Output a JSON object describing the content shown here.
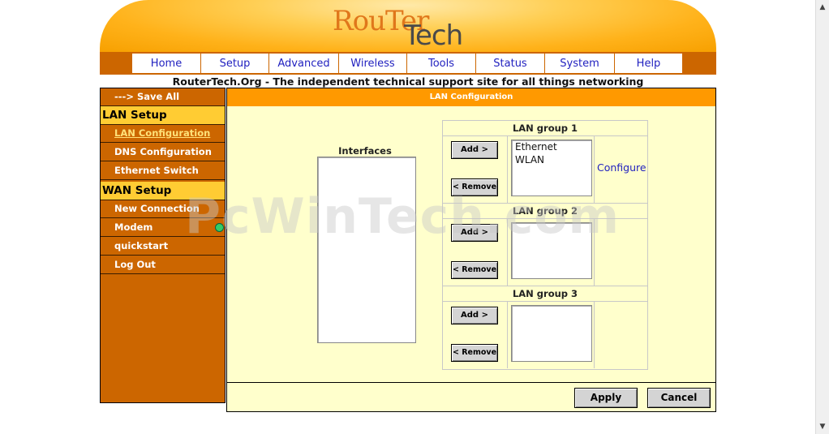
{
  "logo": {
    "part1": "RouTer",
    "part2": "Tech"
  },
  "nav": [
    "Home",
    "Setup",
    "Advanced",
    "Wireless",
    "Tools",
    "Status",
    "System",
    "Help"
  ],
  "tagline": "RouterTech.Org - The independent technical support site for all things networking",
  "sidebar": {
    "save_all": "---> Save All",
    "lan_header": "LAN Setup",
    "lan_items": [
      "LAN Configuration",
      "DNS Configuration",
      "Ethernet Switch"
    ],
    "wan_header": "WAN Setup",
    "wan_items": [
      "New Connection",
      "Modem",
      "quickstart",
      "Log Out"
    ]
  },
  "main": {
    "title": "LAN Configuration",
    "interfaces_label": "Interfaces",
    "groups": [
      {
        "title": "LAN group 1",
        "items": [
          "Ethernet",
          "WLAN"
        ],
        "configure": "Configure"
      },
      {
        "title": "LAN group 2",
        "items": []
      },
      {
        "title": "LAN group 3",
        "items": []
      }
    ],
    "add_label": "Add >",
    "remove_label": "< Remove",
    "apply_label": "Apply",
    "cancel_label": "Cancel"
  },
  "watermark": "PcWinTech.com",
  "colors": {
    "orange": "#cc6600",
    "header_bg": "#ff9900",
    "panel_bg": "#ffffcc",
    "highlight": "#ffcc33"
  }
}
